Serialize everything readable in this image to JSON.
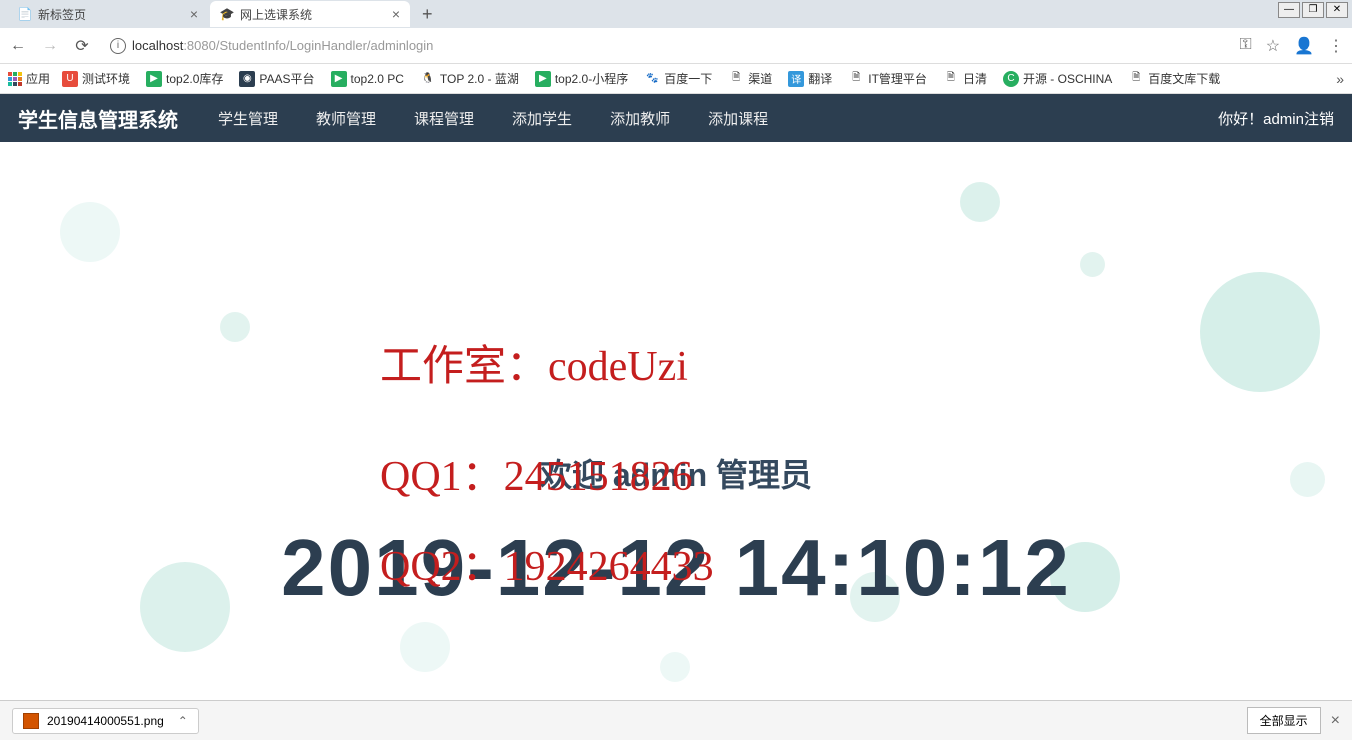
{
  "window": {
    "minimize": "—",
    "maximize": "❐",
    "close": "✕"
  },
  "tabs": [
    {
      "title": "新标签页",
      "active": false
    },
    {
      "title": "网上选课系统",
      "active": true
    }
  ],
  "address": {
    "url_host": "localhost",
    "url_port": ":8080",
    "url_path": "/StudentInfo/LoginHandler/adminlogin"
  },
  "bookmarks": {
    "apps_label": "应用",
    "items": [
      {
        "label": "测试环境",
        "color": "#e74c3c",
        "glyph": "U"
      },
      {
        "label": "top2.0库存",
        "color": "#27ae60",
        "glyph": "▶"
      },
      {
        "label": "PAAS平台",
        "color": "#2c3e50",
        "glyph": "◉"
      },
      {
        "label": "top2.0 PC",
        "color": "#27ae60",
        "glyph": "▶"
      },
      {
        "label": "TOP 2.0 - 蓝湖",
        "color": "#3498db",
        "glyph": "🐧"
      },
      {
        "label": "top2.0-小程序",
        "color": "#27ae60",
        "glyph": "▶"
      },
      {
        "label": "百度一下",
        "color": "#fff",
        "glyph": "🐾"
      },
      {
        "label": "渠道",
        "color": "#fff",
        "glyph": "🗎"
      },
      {
        "label": "翻译",
        "color": "#3498db",
        "glyph": "译"
      },
      {
        "label": "IT管理平台",
        "color": "#fff",
        "glyph": "🗎"
      },
      {
        "label": "日清",
        "color": "#fff",
        "glyph": "🗎"
      },
      {
        "label": "开源 - OSCHINA",
        "color": "#27ae60",
        "glyph": "C"
      },
      {
        "label": "百度文库下载",
        "color": "#fff",
        "glyph": "🗎"
      }
    ]
  },
  "app": {
    "brand": "学生信息管理系统",
    "nav": [
      "学生管理",
      "教师管理",
      "课程管理",
      "添加学生",
      "添加教师",
      "添加课程"
    ],
    "greeting_prefix": "你好！",
    "username": "admin",
    "logout": "注销"
  },
  "main": {
    "welcome": "欢迎 admin 管理员",
    "datetime": "2019-12-12 14:10:12",
    "watermark": {
      "line1": "工作室：codeUzi",
      "line2": "QQ1：245151826",
      "line3": "QQ2：1924264433"
    }
  },
  "downloads": {
    "file": "20190414000551.png",
    "show_all": "全部显示"
  }
}
